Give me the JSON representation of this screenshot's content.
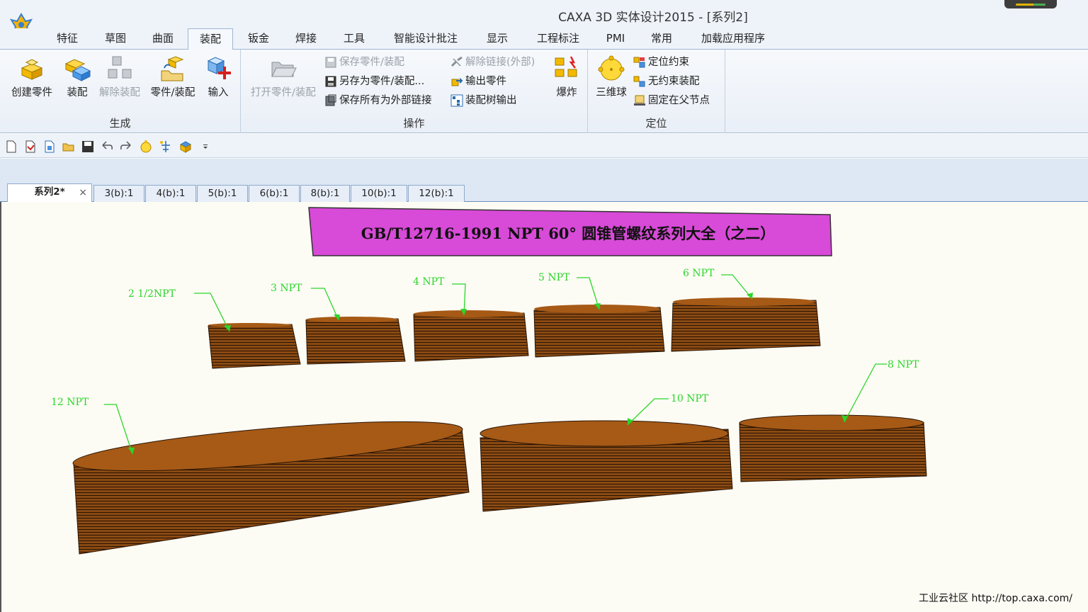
{
  "window": {
    "title": "CAXA 3D 实体设计2015 - [系列2]"
  },
  "ribbon_tabs": [
    "特征",
    "草图",
    "曲面",
    "装配",
    "钣金",
    "焊接",
    "工具",
    "智能设计批注",
    "显示",
    "工程标注",
    "PMI",
    "常用",
    "加载应用程序"
  ],
  "active_tab": "装配",
  "groups": {
    "generate": {
      "label": "生成",
      "buttons": [
        "创建零件",
        "装配",
        "解除装配",
        "零件/装配",
        "输入"
      ]
    },
    "operate": {
      "label": "操作",
      "open_label": "打开零件/装配",
      "col1": [
        "保存零件/装配",
        "另存为零件/装配...",
        "保存所有为外部链接"
      ],
      "col2": [
        "解除链接(外部)",
        "输出零件",
        "装配树输出"
      ],
      "explode_label": "爆炸"
    },
    "position": {
      "label": "定位",
      "ball_label": "三维球",
      "items": [
        "定位约束",
        "无约束装配",
        "固定在父节点"
      ]
    }
  },
  "doc_tabs": [
    "系列2*",
    "3(b):1",
    "4(b):1",
    "5(b):1",
    "6(b):1",
    "8(b):1",
    "10(b):1",
    "12(b):1"
  ],
  "scene": {
    "banner": "GB/T12716-1991   NPT 60°  圆锥管螺纹系列大全（之二）",
    "labels": [
      "2 1/2NPT",
      "3 NPT",
      "4 NPT",
      "5 NPT",
      "6 NPT",
      "12 NPT",
      "10 NPT",
      "8 NPT"
    ]
  },
  "footer": "工业云社区 http://top.caxa.com/",
  "colors": {
    "thread_body": "#8a4a13",
    "thread_top": "#a65a16",
    "leader": "#2bd62b",
    "banner": "#d84ad8"
  }
}
